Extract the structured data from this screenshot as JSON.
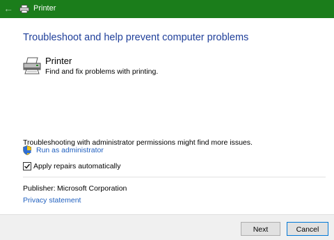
{
  "window": {
    "title": "Printer",
    "icons": {
      "back": "back-arrow-icon",
      "app": "printer-icon"
    }
  },
  "main": {
    "heading": "Troubleshoot and help prevent computer problems",
    "item": {
      "title": "Printer",
      "description": "Find and fix problems with printing.",
      "icon": "printer-icon"
    },
    "admin_note": "Troubleshooting with administrator permissions might find more issues.",
    "admin_link": "Run as administrator",
    "admin_icon": "uac-shield-icon",
    "checkbox": {
      "label": "Apply repairs automatically",
      "checked": true
    },
    "publisher": {
      "label": "Publisher:",
      "value": "Microsoft Corporation"
    },
    "privacy_link": "Privacy statement"
  },
  "footer": {
    "next_label": "Next",
    "cancel_label": "Cancel"
  },
  "colors": {
    "titlebar": "#1b7d1b",
    "heading": "#1f3f9a",
    "link": "#1f5fbf",
    "footer_bg": "#f0f0f0"
  }
}
